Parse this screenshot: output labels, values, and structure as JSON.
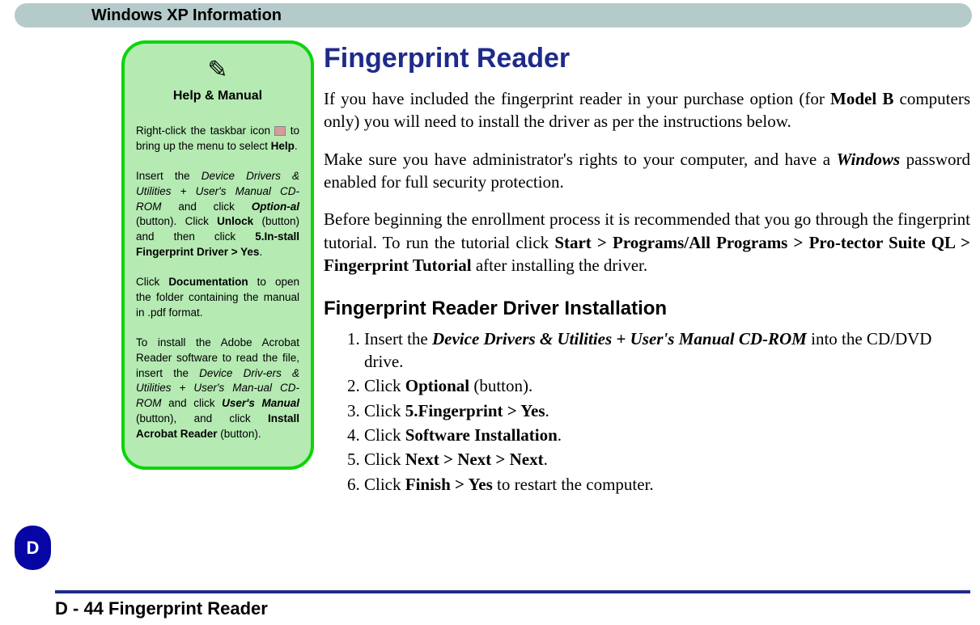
{
  "header": {
    "title": "Windows XP Information"
  },
  "sidebar": {
    "tab": "D"
  },
  "tip": {
    "title": "Help & Manual",
    "p1a": "Right-click the taskbar icon ",
    "p1b": " to bring up the menu to select ",
    "p1c": "Help",
    "p1d": ".",
    "p2a": "Insert the ",
    "p2b": "Device Drivers & Utilities + User's Manual CD-ROM",
    "p2c": " and click ",
    "p2d": "Option-al",
    "p2e": " (button). Click ",
    "p2f": "Unlock",
    "p2g": " (button) and then click ",
    "p2h": "5.In-stall Fingerprint Driver > Yes",
    "p2i": ".",
    "p3a": "Click ",
    "p3b": "Documentation",
    "p3c": " to open the folder containing the manual in .pdf format.",
    "p4a": "To install the Adobe Acrobat Reader software to read the file, insert the ",
    "p4b": "Device Driv-ers & Utilities + User's Man-ual CD-ROM",
    "p4c": " and click ",
    "p4d": "User's Manual",
    "p4e": " (button), and click ",
    "p4f": "Install Acrobat Reader",
    "p4g": " (button)."
  },
  "main": {
    "title": "Fingerprint Reader",
    "p1a": "If you have included the fingerprint reader in your purchase option (for ",
    "p1b": "Model B",
    "p1c": " computers only) you will need to install the driver as per the instructions below.",
    "p2a": "Make sure you have administrator's rights to your computer, and have a ",
    "p2b": "Windows",
    "p2c": " password enabled for full security protection.",
    "p3a": "Before beginning the enrollment process it is recommended that you go through the fingerprint tutorial. To run the tutorial click ",
    "p3b": "Start > Programs/All Programs > Pro-tector Suite QL > Fingerprint Tutorial",
    "p3c": " after installing the driver.",
    "subtitle": "Fingerprint Reader Driver Installation",
    "steps": {
      "s1a": "Insert the ",
      "s1b": "Device Drivers & Utilities + User's Manual CD-ROM",
      "s1c": " into the CD/DVD drive.",
      "s2a": "Click ",
      "s2b": "Optional",
      "s2c": " (button).",
      "s3a": "Click ",
      "s3b": "5.Fingerprint > Yes",
      "s3c": ".",
      "s4a": "Click ",
      "s4b": "Software Installation",
      "s4c": ".",
      "s5a": "Click ",
      "s5b": "Next > Next > Next",
      "s5c": ".",
      "s6a": "Click ",
      "s6b": "Finish > Yes",
      "s6c": " to restart the computer."
    }
  },
  "footer": {
    "text": "D - 44 Fingerprint Reader"
  }
}
